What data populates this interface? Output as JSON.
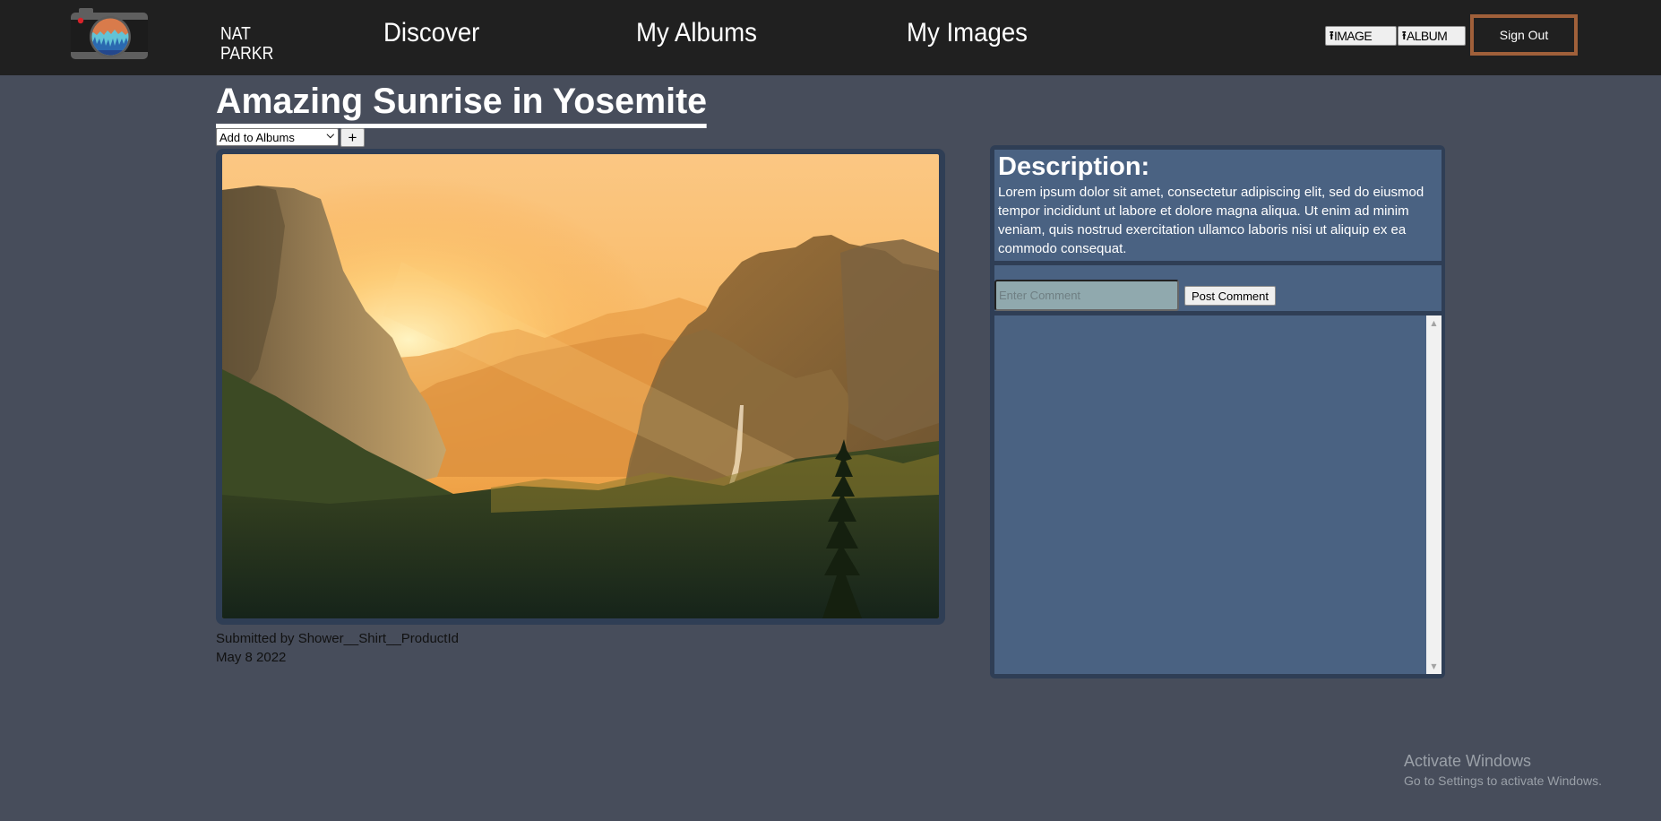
{
  "brand": {
    "line1": "NAT",
    "line2": "PARKR",
    "logo_icon": "camera-logo-icon"
  },
  "nav": {
    "links": [
      {
        "label": "Discover"
      },
      {
        "label": "My Albums"
      },
      {
        "label": "My Images"
      }
    ],
    "upload_image": {
      "icon": "upload-icon",
      "label": "IMAGE"
    },
    "upload_album": {
      "icon": "upload-icon",
      "label": "ALBUM"
    },
    "sign_out": "Sign Out"
  },
  "colors": {
    "header_bg": "#202020",
    "page_bg": "#474d5b",
    "panel_bg": "#4a6282",
    "frame": "#2f3e55",
    "sign_out_border": "#a0603a"
  },
  "image": {
    "title": "Amazing Sunrise in Yosemite",
    "album_select": {
      "selected": "Add to Albums",
      "options": [
        "Add to Albums"
      ]
    },
    "add_album_label": "+",
    "submitted_by": "Submitted by Shower__Shirt__ProductId",
    "date": "May 8 2022",
    "photo_alt": "Sunrise over Yosemite Valley with cliffs, waterfall and pine forest"
  },
  "description": {
    "heading": "Description:",
    "body": "Lorem ipsum dolor sit amet, consectetur adipiscing elit, sed do eiusmod tempor incididunt ut labore et dolore magna aliqua. Ut enim ad minim veniam, quis nostrud exercitation ullamco laboris nisi ut aliquip ex ea commodo consequat."
  },
  "comments": {
    "input_value": "",
    "input_placeholder": "Enter Comment",
    "post_label": "Post Comment",
    "items": []
  },
  "os_watermark": {
    "title": "Activate Windows",
    "subtitle": "Go to Settings to activate Windows."
  }
}
